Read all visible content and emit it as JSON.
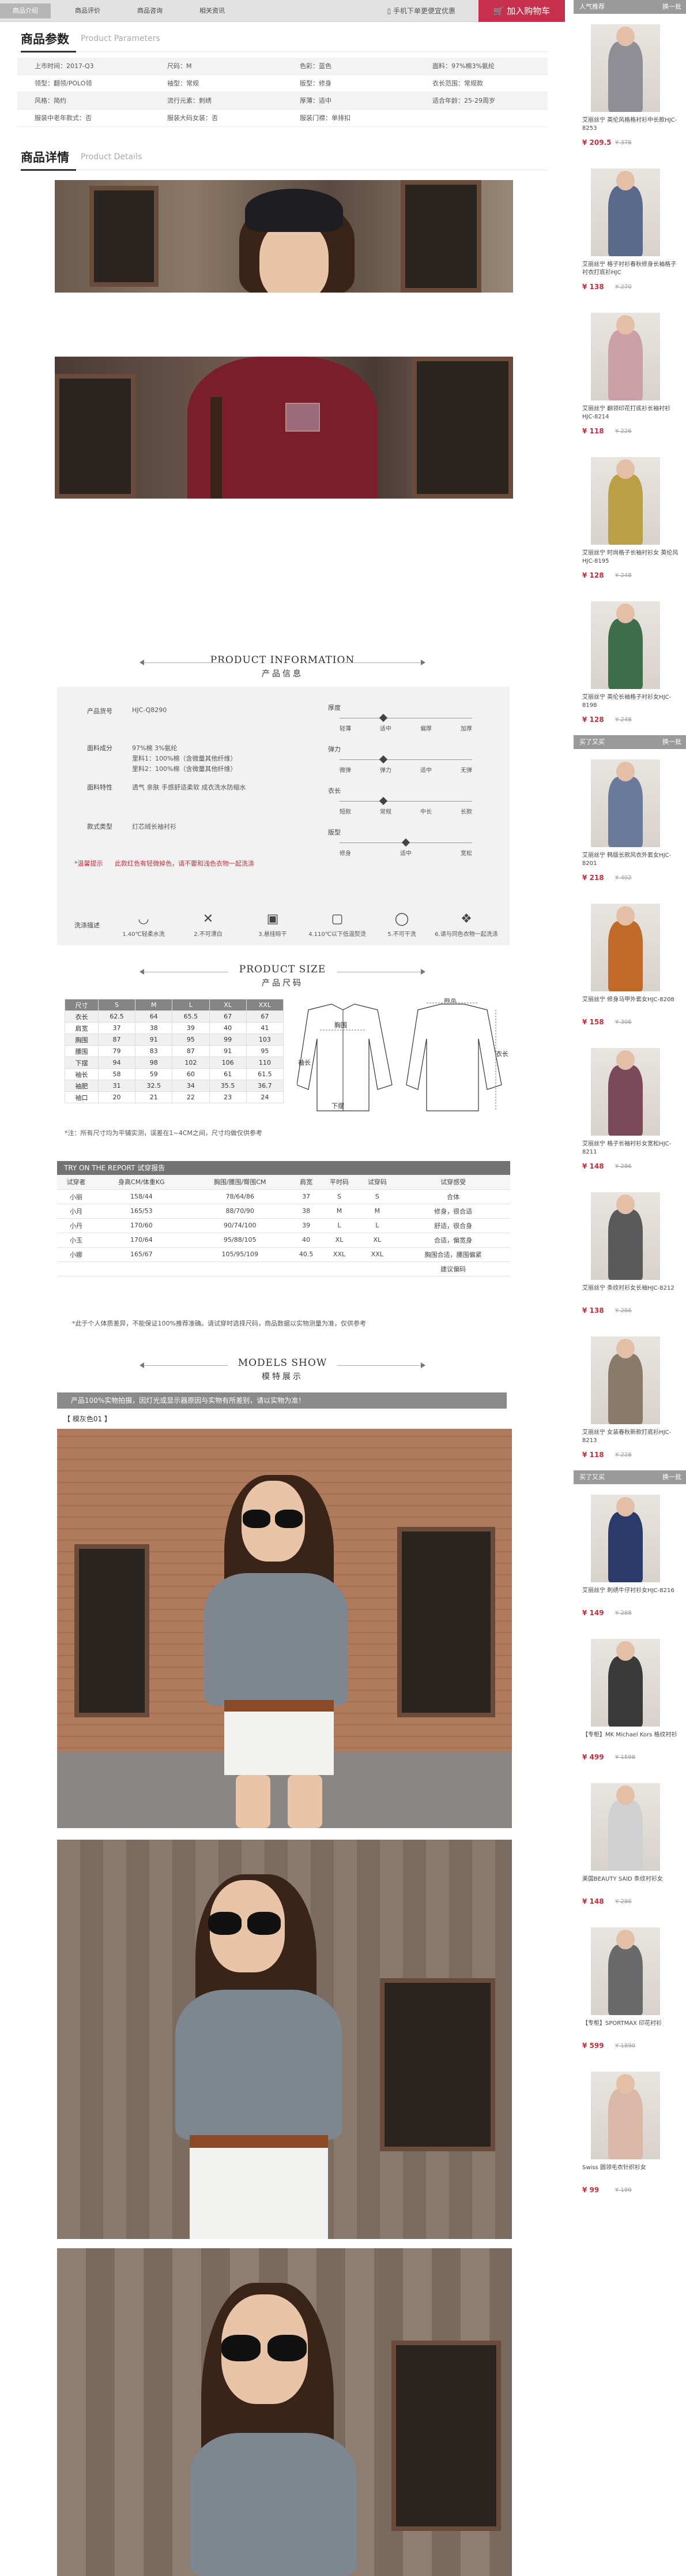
{
  "topbar": {
    "tabs": [
      "商品介绍",
      "商品评价",
      "商品咨询",
      "相关资讯"
    ],
    "mobile_text": "手机下单更便宜优惠",
    "cart_label": "加入购物车"
  },
  "params_section": {
    "title": "商品参数",
    "subtitle": "Product Parameters"
  },
  "params": [
    [
      "上市时间：2017-Q3",
      "尺码：M",
      "色彩：蓝色",
      "面料：97%棉3%氨纶"
    ],
    [
      "领型：翻领/POLO领",
      "袖型：常规",
      "版型：修身",
      "衣长范围：常规款"
    ],
    [
      "风格：简约",
      "流行元素：刺绣",
      "厚薄：适中",
      "适合年龄：25-29周岁"
    ],
    [
      "服装中老年款式：否",
      "服装大码女装：否",
      "服装门襟：单排扣",
      ""
    ]
  ],
  "detail_section": {
    "title": "商品详情",
    "subtitle": "Product Details"
  },
  "product_info": {
    "title_en": "PRODUCT INFORMATION",
    "title_cn": "产品信息",
    "code_label": "产品货号",
    "code": "HJC-Q8290",
    "fabric_label": "面料成分",
    "fabric": [
      "97%棉 3%氨纶",
      "里料1：100%棉（含微量其他纤维）",
      "里料2：100%棉（含微量其他纤维）"
    ],
    "feature_label": "面料特性",
    "feature": "透气 亲肤 手感舒适柔软 成衣洗水防缩水",
    "style_label": "款式类型",
    "style": "灯芯绒长袖衬衫",
    "warn_label": "*温馨提示",
    "warn": "此款红色有轻微掉色，请不要和浅色衣物一起洗涤",
    "scales": [
      {
        "name": "厚度",
        "opts": [
          "轻薄",
          "适中",
          "偏厚",
          "加厚"
        ],
        "level": 0.33
      },
      {
        "name": "弹力",
        "opts": [
          "微弹",
          "弹力",
          "适中",
          "无弹"
        ],
        "level": 0.33
      },
      {
        "name": "衣长",
        "opts": [
          "短款",
          "常规",
          "中长",
          "长款"
        ],
        "level": 0.33
      },
      {
        "name": "版型",
        "opts": [
          "修身",
          "适中",
          "宽松"
        ],
        "level": 0.5
      }
    ],
    "wash_label": "洗涤描述",
    "wash": [
      {
        "icon": "◡",
        "text": "1.40℃轻柔水洗"
      },
      {
        "icon": "✕",
        "text": "2.不可漂白"
      },
      {
        "icon": "▣",
        "text": "3.悬挂晾干"
      },
      {
        "icon": "▢",
        "text": "4.110℃以下低温熨烫"
      },
      {
        "icon": "◯",
        "text": "5.不可干洗"
      },
      {
        "icon": "❖",
        "text": "6.请与同色衣物一起洗涤"
      }
    ]
  },
  "size_info": {
    "title_en": "PRODUCT SIZE",
    "title_cn": "产品尺码",
    "headers": [
      "尺寸",
      "S",
      "M",
      "L",
      "XL",
      "XXL"
    ],
    "rows": [
      [
        "衣长",
        "62.5",
        "64",
        "65.5",
        "67",
        "67"
      ],
      [
        "肩宽",
        "37",
        "38",
        "39",
        "40",
        "41"
      ],
      [
        "胸围",
        "87",
        "91",
        "95",
        "99",
        "103"
      ],
      [
        "腰围",
        "79",
        "83",
        "87",
        "91",
        "95"
      ],
      [
        "下摆",
        "94",
        "98",
        "102",
        "106",
        "110"
      ],
      [
        "袖长",
        "58",
        "59",
        "60",
        "61",
        "61.5"
      ],
      [
        "袖肥",
        "31",
        "32.5",
        "34",
        "35.5",
        "36.7"
      ],
      [
        "袖口",
        "20",
        "21",
        "22",
        "23",
        "24"
      ]
    ],
    "note": "*注：所有尺寸均为平铺实测，误差在1~4CM之间，尺寸均做仅供参考",
    "diagram_labels": [
      "衣长",
      "肩宽",
      "袖长",
      "胸围",
      "下摆"
    ]
  },
  "tryon": {
    "title": "TRY ON THE REPORT  试穿报告",
    "headers": [
      "试穿者",
      "身高CM/体重KG",
      "胸围/腰围/臀围CM",
      "肩宽",
      "平时码",
      "试穿码",
      "试穿感受"
    ],
    "rows": [
      [
        "小丽",
        "158/44",
        "78/64/86",
        "37",
        "S",
        "S",
        "合体"
      ],
      [
        "小月",
        "165/53",
        "88/70/90",
        "38",
        "M",
        "M",
        "修身，很合适"
      ],
      [
        "小丹",
        "170/60",
        "90/74/100",
        "39",
        "L",
        "L",
        "舒适，很合身"
      ],
      [
        "小玉",
        "170/64",
        "95/88/105",
        "40",
        "XL",
        "XL",
        "合适，偏宽身"
      ],
      [
        "小娜",
        "165/67",
        "105/95/109",
        "40.5",
        "XXL",
        "XXL",
        "胸围合适，腰围偏紧"
      ],
      [
        "",
        "",
        "",
        "",
        "",
        "",
        "建议偏码"
      ]
    ],
    "note": "*此于个人体质差异，不能保证100%推荐准确。请试穿时选择尺码，商品数据以实物测量为准，仅供参考"
  },
  "models": {
    "title_en": "MODELS SHOW",
    "title_cn": "模特展示",
    "strip": "产品100%实物拍摄，因灯光或显示器原因与实物有所差别，请以实物为准！",
    "label": "【 模灰色01 】"
  },
  "sidebar": {
    "sections": [
      {
        "title": "人气推荐",
        "more": "换一批",
        "items": [
          {
            "name": "艾丽丝宁 英伦风格格衬衫中长款HJC-8253",
            "price": "¥ 209.5",
            "old": "¥ 378"
          },
          {
            "name": "艾丽丝宁 格子衬衫春秋修身长袖格子衬衣打底衫HJC",
            "price": "¥ 138",
            "old": "¥ 270"
          },
          {
            "name": "艾丽丝宁 翻领印花打底衫长袖衬衫HJC-8214",
            "price": "¥ 118",
            "old": "¥ 226"
          },
          {
            "name": "艾丽丝宁 时尚格子长袖衬衫女 英伦风HJC-8195",
            "price": "¥ 128",
            "old": "¥ 248"
          },
          {
            "name": "艾丽丝宁 英伦长袖格子衬衫女HJC-8198",
            "price": "¥ 128",
            "old": "¥ 248"
          }
        ]
      },
      {
        "title": "买了又买",
        "more": "换一批",
        "items": [
          {
            "name": "艾丽丝宁 韩版长款风衣外套女HJC-8201",
            "price": "¥ 218",
            "old": "¥ 402"
          },
          {
            "name": "艾丽丝宁 修身马甲外套女HJC-8208",
            "price": "¥ 158",
            "old": "¥ 306"
          },
          {
            "name": "艾丽丝宁 格子长袖衬衫女宽松HJC-8211",
            "price": "¥ 148",
            "old": "¥ 286"
          },
          {
            "name": "艾丽丝宁 条纹衬衫女长袖HJC-8212",
            "price": "¥ 138",
            "old": "¥ 266"
          },
          {
            "name": "艾丽丝宁 女装春秋新款打底衫HJC-8213",
            "price": "¥ 118",
            "old": "¥ 228"
          }
        ]
      },
      {
        "title": "买了又买",
        "more": "换一批",
        "items": [
          {
            "name": "艾丽丝宁 刺绣牛仔衬衫女HJC-8216",
            "price": "¥ 149",
            "old": "¥ 288"
          },
          {
            "name": "【专柜】MK Michael Kors 格纹衬衫",
            "price": "¥ 499",
            "old": "¥ 1598"
          },
          {
            "name": "美国BEAUTY SAID 条纹衬衫女",
            "price": "¥ 148",
            "old": "¥ 286"
          },
          {
            "name": "【专柜】SPORTMAX 印花衬衫",
            "price": "¥ 599",
            "old": "¥ 1890"
          },
          {
            "name": "Swiss 圆领毛衣针织衫女",
            "price": "¥ 99",
            "old": "¥ 199"
          }
        ]
      }
    ]
  },
  "colors": {
    "accent": "#c6304c",
    "bar": "#9a9a9a"
  }
}
